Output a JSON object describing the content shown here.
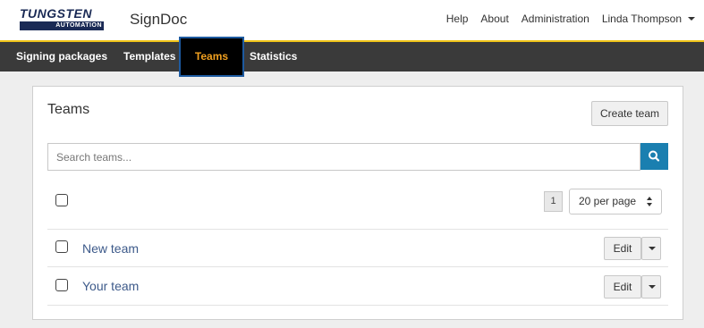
{
  "brand": {
    "logo_top": "TUNGSTEN",
    "logo_bottom": "AUTOMATION",
    "app_title": "SignDoc"
  },
  "header_links": {
    "help": "Help",
    "about": "About",
    "administration": "Administration",
    "user": "Linda Thompson"
  },
  "nav": {
    "items": [
      {
        "label": "Signing packages"
      },
      {
        "label": "Templates"
      },
      {
        "label": "Teams",
        "active": true
      },
      {
        "label": "Statistics"
      }
    ]
  },
  "teams_panel": {
    "title": "Teams",
    "create_button": "Create team",
    "search_placeholder": "Search teams...",
    "page_number": "1",
    "per_page": "20 per page",
    "rows": [
      {
        "name": "New team",
        "edit_label": "Edit"
      },
      {
        "name": "Your team",
        "edit_label": "Edit"
      }
    ]
  },
  "colors": {
    "accent_yellow": "#f0c419",
    "nav_bg": "#3a3a3a",
    "active_text": "#f0a020",
    "search_button": "#1a7fb0",
    "link": "#3d5a8a"
  }
}
